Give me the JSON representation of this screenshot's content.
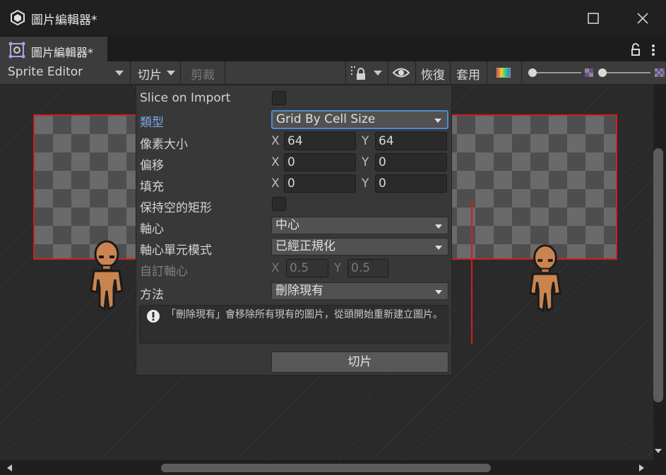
{
  "window": {
    "title": "圖片編輯器*"
  },
  "tab": {
    "label": "圖片編輯器*"
  },
  "toolbar": {
    "mode_dropdown": "Sprite Editor",
    "slice_menu": "切片",
    "trim_button": "剪裁",
    "revert_button": "恢復",
    "apply_button": "套用"
  },
  "slice_panel": {
    "slice_on_import_label": "Slice on Import",
    "type_label": "類型",
    "type_value": "Grid By Cell Size",
    "pixel_size_label": "像素大小",
    "pixel_size": {
      "x_label": "X",
      "x": "64",
      "y_label": "Y",
      "y": "64"
    },
    "offset_label": "偏移",
    "offset": {
      "x_label": "X",
      "x": "0",
      "y_label": "Y",
      "y": "0"
    },
    "padding_label": "填充",
    "padding": {
      "x_label": "X",
      "x": "0",
      "y_label": "Y",
      "y": "0"
    },
    "keep_empty_label": "保持空的矩形",
    "pivot_label": "軸心",
    "pivot_value": "中心",
    "pivot_unit_label": "軸心單元模式",
    "pivot_unit_value": "已經正規化",
    "custom_pivot_label": "自訂軸心",
    "custom_pivot": {
      "x_label": "X",
      "x": "0.5",
      "y_label": "Y",
      "y": "0.5"
    },
    "method_label": "方法",
    "method_value": "刪除現有",
    "help_text": "「刪除現有」會移除所有現有的圖片，從頭開始重新建立圖片。",
    "slice_button": "切片"
  },
  "colors": {
    "accent_blue": "#4d8bd6",
    "slice_border": "#d01e1e",
    "label_blue": "#7aa7e8"
  },
  "icons": [
    "unity-icon",
    "maximize-icon",
    "close-icon",
    "sprite-editor-tab-icon",
    "lock-icon",
    "more-icon",
    "lock-dropdown-icon",
    "eye-icon",
    "color-channel-icon",
    "zoom-slider",
    "mip-slider",
    "alert-icon"
  ]
}
